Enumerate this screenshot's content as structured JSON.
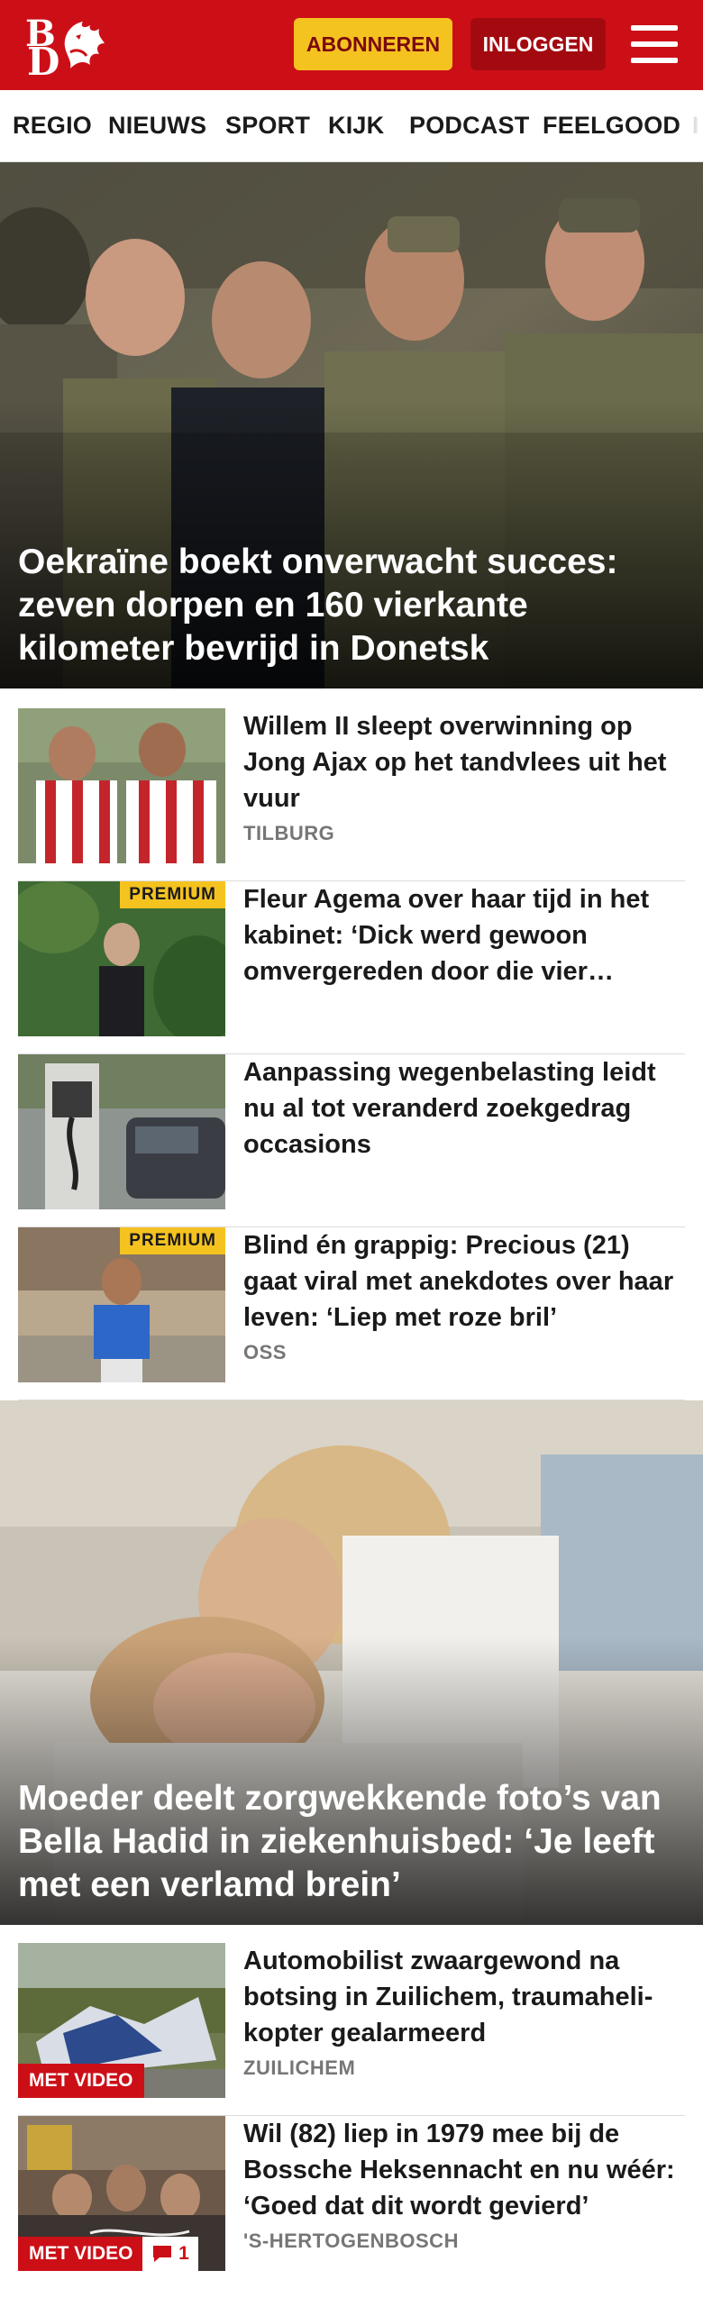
{
  "header": {
    "logo_letters": [
      "B",
      "D"
    ],
    "subscribe_label": "ABONNEREN",
    "login_label": "INLOGGEN",
    "menu_icon": "hamburger-menu-icon",
    "brand_color": "#cc0f17",
    "accent_color": "#f5c320"
  },
  "nav": {
    "items": [
      "REGIO",
      "NIEUWS",
      "SPORT",
      "KIJK",
      "PODCAST",
      "FEELGOOD"
    ]
  },
  "hero1": {
    "title": "Oekraïne boekt onverwacht succes: zeven dorpen en 160 vierkante kilometer bevrijd in Donetsk"
  },
  "articles1": [
    {
      "title": "Willem II sleept overwinning op Jong Ajax op het tandvlees uit het vuur",
      "location": "TILBURG"
    },
    {
      "title": "Fleur Agema over haar tijd in het kabinet: ‘Dick werd gewoon omvergereden door die vier vrouwen’",
      "badge": "PREMIUM"
    },
    {
      "title": "Aanpassing wegenbelasting leidt nu al tot veranderd zoekgedrag occasions"
    },
    {
      "title": "Blind én grappig: Precious (21) gaat viral met anekdotes over haar leven: ‘Liep met roze bril’",
      "badge": "PREMIUM",
      "location": "OSS"
    }
  ],
  "hero2": {
    "title": "Moeder deelt zorgwekkende foto’s van Bella Hadid in ziekenhuisbed: ‘Je leeft met een verlamd brein’"
  },
  "articles2": [
    {
      "title": "Automobilist zwaargewond na botsing in Zuilichem, traumaheli­kopter gealarmeerd",
      "location": "ZUILICHEM",
      "video": "MET VIDEO"
    },
    {
      "title": "Wil (82) liep in 1979 mee bij de Bossche Heksennacht en nu wéér: ‘Goed dat dit wordt gevierd’",
      "location": "'S-HERTOGENBOSCH",
      "video": "MET VIDEO",
      "comments": "1"
    }
  ]
}
